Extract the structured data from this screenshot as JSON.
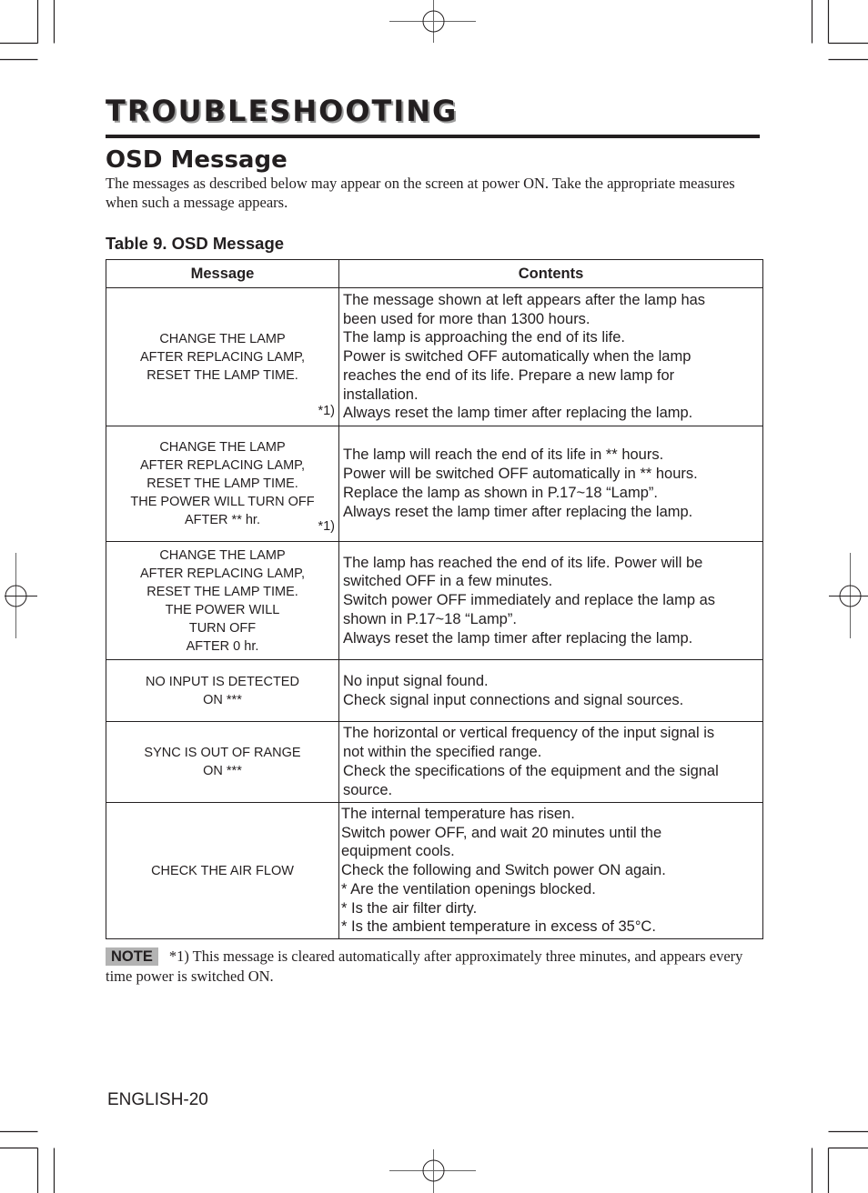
{
  "header": {
    "title": "TROUBLESHOOTING",
    "section_title": "OSD Message",
    "intro": "The messages as described below may appear on the screen at power ON. Take the appropriate measures when such a message appears."
  },
  "table": {
    "caption": "Table 9. OSD Message",
    "columns": [
      "Message",
      "Contents"
    ],
    "rows": [
      {
        "message": [
          "CHANGE THE LAMP",
          "AFTER REPLACING LAMP,",
          "RESET THE LAMP TIME."
        ],
        "ref": "*1)",
        "contents": [
          "The message shown at left appears after the lamp has",
          "been used for more than 1300 hours.",
          "The lamp is approaching the end of its life.",
          "Power is switched OFF automatically when the lamp",
          "reaches the end of its life. Prepare a new lamp for",
          "installation.",
          "Always reset the lamp timer after replacing the lamp."
        ]
      },
      {
        "message": [
          "CHANGE THE LAMP",
          "AFTER REPLACING LAMP,",
          "RESET THE LAMP TIME.",
          "THE POWER WILL TURN OFF",
          "AFTER ** hr."
        ],
        "ref": "*1)",
        "contents": [
          "The lamp will reach the end of its life in ** hours.",
          "Power will be switched OFF automatically in ** hours.",
          "Replace the lamp as shown in P.17~18 “Lamp”.",
          "Always reset the lamp timer after replacing the lamp."
        ]
      },
      {
        "message": [
          "CHANGE THE LAMP",
          "AFTER REPLACING LAMP,",
          "RESET THE LAMP TIME.",
          "THE POWER WILL",
          "TURN OFF",
          "AFTER 0 hr."
        ],
        "ref": "",
        "contents": [
          "The lamp has reached the end of its life. Power will be",
          "switched OFF in a few minutes.",
          "Switch power OFF immediately and replace the lamp as",
          "shown in P.17~18 “Lamp”.",
          "Always reset the lamp timer after replacing the lamp."
        ]
      },
      {
        "message": [
          "NO INPUT IS DETECTED",
          "ON ***"
        ],
        "ref": "",
        "contents": [
          "No input signal found.",
          "Check signal input connections and signal sources."
        ]
      },
      {
        "message": [
          "SYNC IS OUT OF RANGE",
          "ON ***"
        ],
        "ref": "",
        "contents": [
          "The horizontal or vertical frequency of the input signal is",
          "not within the specified range.",
          "Check the specifications of the equipment and the signal",
          "source."
        ]
      },
      {
        "message": [
          "CHECK THE AIR FLOW"
        ],
        "ref": "",
        "contents": [
          "The internal temperature has risen.",
          "Switch power OFF, and wait 20 minutes until the",
          "equipment cools.",
          "Check the following and Switch power ON again.",
          "* Are the ventilation openings blocked.",
          "* Is the air filter dirty.",
          "* Is the ambient temperature in excess of 35°C."
        ]
      }
    ]
  },
  "note": {
    "badge": "NOTE",
    "text": "*1) This message is cleared automatically after approximately three minutes, and appears every time power is switched ON."
  },
  "footer": {
    "page_number": "ENGLISH-20"
  }
}
